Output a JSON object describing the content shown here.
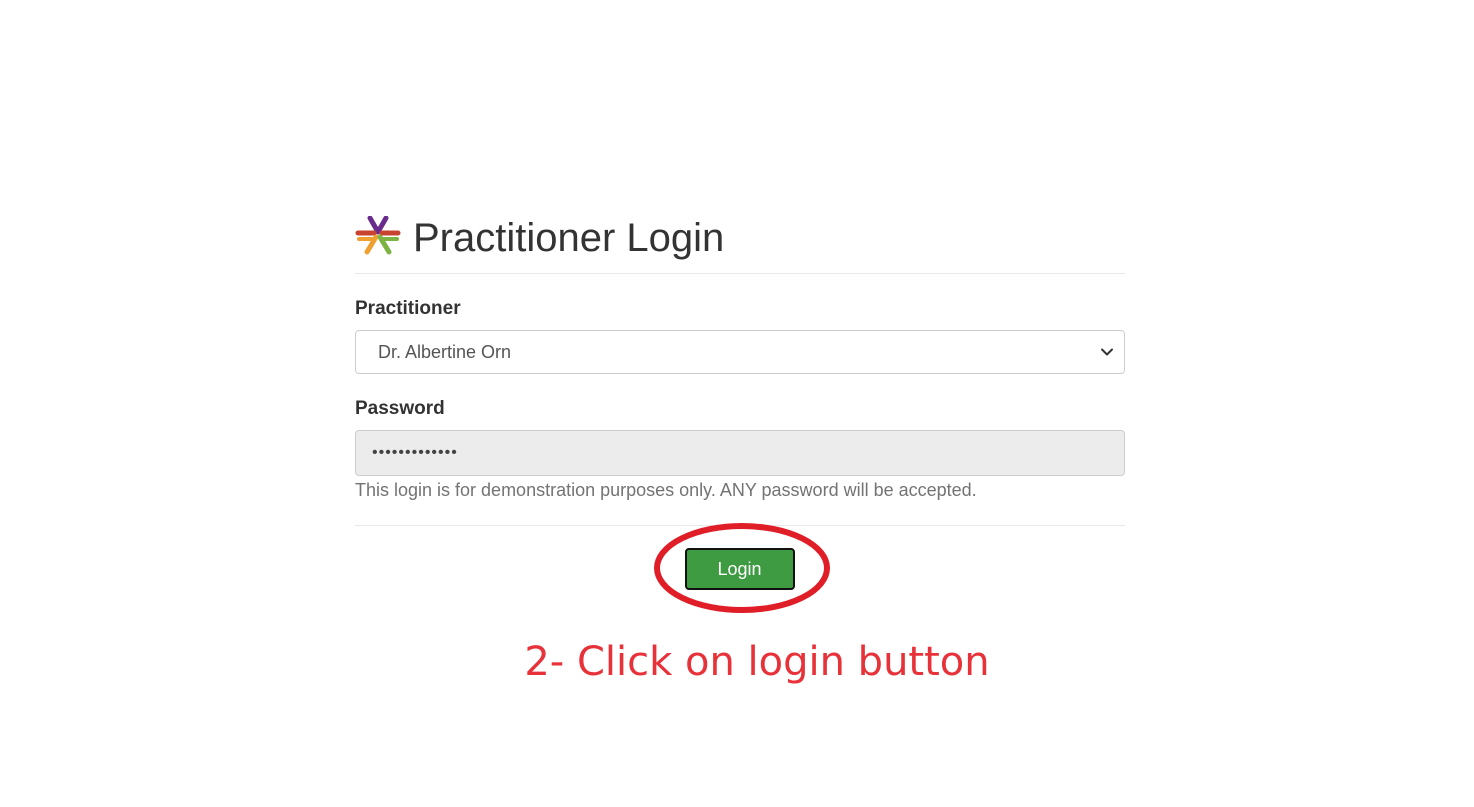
{
  "header": {
    "title": "Practitioner Login",
    "logo_icon": "starburst-logo-icon"
  },
  "form": {
    "practitioner_label": "Practitioner",
    "practitioner_selected": "Dr. Albertine Orn",
    "password_label": "Password",
    "password_value": "•••••••••••••",
    "help_text": "This login is for demonstration purposes only. ANY password will be accepted.",
    "login_label": "Login"
  },
  "annotation": {
    "text": "2- Click on login button",
    "color": "#e8323a"
  },
  "colors": {
    "login_button": "#3e9b41",
    "logo_purple": "#6a2c8c",
    "logo_red": "#c8432f",
    "logo_orange": "#f0a030",
    "logo_green": "#7cb342"
  }
}
